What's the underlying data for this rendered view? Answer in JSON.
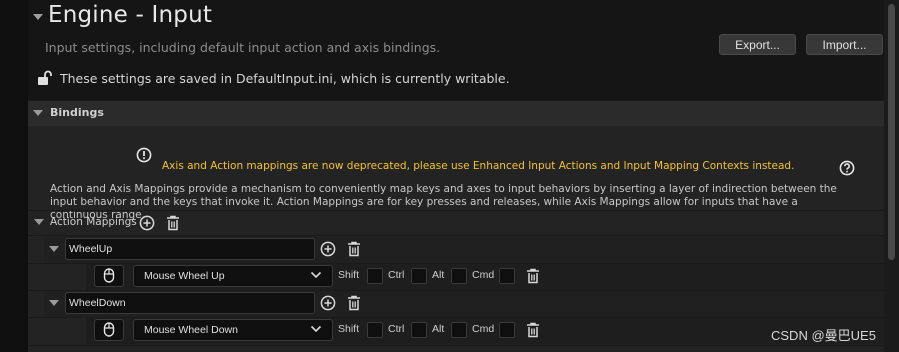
{
  "header": {
    "title": "Engine - Input",
    "subtitle": "Input settings, including default input action and axis bindings.",
    "export_label": "Export...",
    "import_label": "Import...",
    "config_notice": "These settings are saved in DefaultInput.ini, which is currently writable."
  },
  "bindings": {
    "section_label": "Bindings",
    "deprecation_warning": "Axis and Action mappings are now deprecated, please use Enhanced Input Actions and Input Mapping Contexts instead.",
    "description": "Action and Axis Mappings provide a mechanism to conveniently map keys and axes to input behaviors by inserting a layer of indirection between the input behavior and the keys that invoke it. Action Mappings are for key presses and releases, while Axis Mappings allow for inputs that have a continuous range.",
    "action_mappings_label": "Action Mappings",
    "actions": [
      {
        "name": "WheelUp",
        "key": "Mouse Wheel Up",
        "shift": false,
        "ctrl": false,
        "alt": false,
        "cmd": false
      },
      {
        "name": "WheelDown",
        "key": "Mouse Wheel Down",
        "shift": false,
        "ctrl": false,
        "alt": false,
        "cmd": false
      }
    ],
    "modifiers": {
      "shift": "Shift",
      "ctrl": "Ctrl",
      "alt": "Alt",
      "cmd": "Cmd"
    }
  },
  "watermark": "CSDN @曼巴UE5",
  "colors": {
    "warning": "#f5c518",
    "background": "#151515",
    "panel": "#232323"
  }
}
